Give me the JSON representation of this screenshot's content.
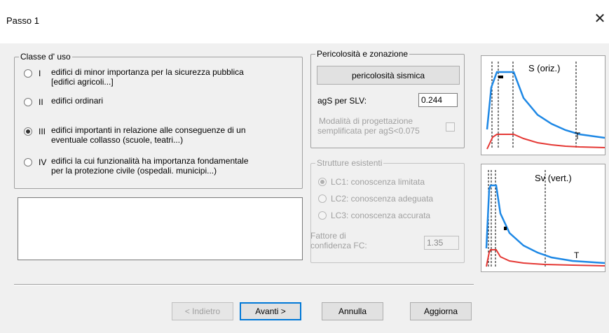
{
  "window": {
    "title": "Passo 1",
    "close_glyph": "✕"
  },
  "classe_uso": {
    "legend": "Classe d' uso",
    "options": [
      {
        "roman": "I",
        "line1": "edifici di minor importanza per la sicurezza pubblica",
        "line2": "[edifici agricoli...]",
        "selected": false
      },
      {
        "roman": "II",
        "line1": "edifici ordinari",
        "line2": "",
        "selected": false
      },
      {
        "roman": "III",
        "line1": "edifici importanti in relazione alle conseguenze di un",
        "line2": "eventuale collasso (scuole, teatri...)",
        "selected": true
      },
      {
        "roman": "IV",
        "line1": "edifici la cui funzionalità ha importanza fondamentale",
        "line2": "per la protezione civile (ospedali. municipi...)",
        "selected": false
      }
    ]
  },
  "notes_text": "",
  "pericolosita": {
    "legend": "Pericolosità e zonazione",
    "button": "pericolosità sismica",
    "ags_label": "agS per SLV:",
    "ags_value": "0.244",
    "mod_line1": "Modalità di progettazione",
    "mod_line2": "semplificata per agS<0.075",
    "mod_checked": false
  },
  "esistenti": {
    "legend": "Strutture esistenti",
    "options": [
      {
        "label": "LC1: conoscenza limitata",
        "selected": true
      },
      {
        "label": "LC2: conoscenza adeguata",
        "selected": false
      },
      {
        "label": "LC3: conoscenza accurata",
        "selected": false
      }
    ],
    "fc_line1": "Fattore di",
    "fc_line2": "confidenza FC:",
    "fc_value": "1.35"
  },
  "charts": {
    "orizzontale": {
      "label": "S (oriz.)",
      "t_label": "T"
    },
    "verticale": {
      "label": "Sv (vert.)",
      "t_label": "T"
    },
    "colors": {
      "design": "#1e88e5",
      "elastic": "#e53935"
    }
  },
  "buttons": {
    "back": "< Indietro",
    "next": "Avanti >",
    "cancel": "Annulla",
    "update": "Aggiorna"
  }
}
